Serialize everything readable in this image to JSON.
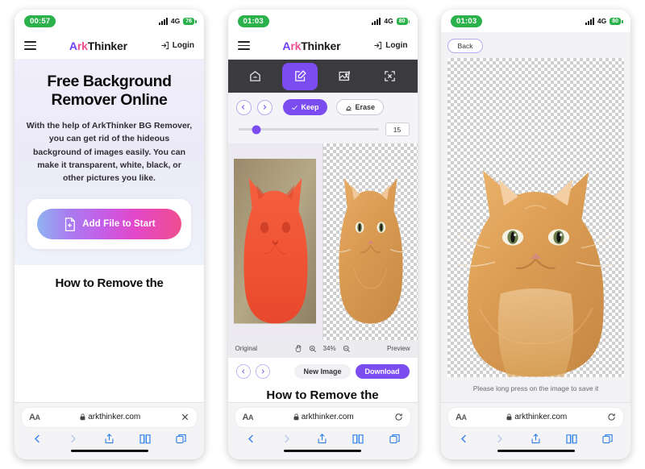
{
  "brand": {
    "prefix": "A",
    "mid": "rk",
    "suffix": "Thinker"
  },
  "phone1": {
    "status": {
      "time": "00:57",
      "network": "4G",
      "battery": "76"
    },
    "header": {
      "login": "Login",
      "menu_icon": "hamburger-menu-icon",
      "login_icon": "login-arrow-icon"
    },
    "hero": {
      "title": "Free Background Remover Online",
      "paragraph": "With the help of ArkThinker BG Remover, you can get rid of the hideous background of images easily. You can make it transparent, white, black, or other pictures you like."
    },
    "cta": {
      "label": "Add File to Start",
      "icon": "file-plus-icon"
    },
    "section_heading": "How to Remove the",
    "safari": {
      "aa": "AA",
      "url": "arkthinker.com",
      "lock_icon": "lock-icon",
      "right_icon": "close-icon"
    }
  },
  "phone2": {
    "status": {
      "time": "01:03",
      "network": "4G",
      "battery": "80"
    },
    "header": {
      "login": "Login"
    },
    "tabs": [
      {
        "name": "home-tab",
        "icon": "home-icon",
        "active": false
      },
      {
        "name": "edit-tab",
        "icon": "edit-pencil-icon",
        "active": true
      },
      {
        "name": "background-tab",
        "icon": "image-icon",
        "active": false
      },
      {
        "name": "resize-tab",
        "icon": "resize-arrows-icon",
        "active": false
      }
    ],
    "controls": {
      "undo_icon": "undo-icon",
      "redo_icon": "redo-icon",
      "keep_label": "Keep",
      "erase_label": "Erase",
      "brush_size": "15"
    },
    "zoombar": {
      "original_label": "Original",
      "hand_icon": "hand-icon",
      "zoom_in_icon": "zoom-in-icon",
      "zoom_level": "34%",
      "zoom_out_icon": "zoom-out-icon",
      "preview_label": "Preview"
    },
    "actions": {
      "prev_icon": "chevron-left-icon",
      "next_icon": "chevron-right-icon",
      "new_image_label": "New Image",
      "download_label": "Download"
    },
    "section_heading": "How to Remove the",
    "safari": {
      "aa": "AA",
      "url": "arkthinker.com",
      "lock_icon": "lock-icon",
      "right_icon": "reload-icon"
    }
  },
  "phone3": {
    "status": {
      "time": "01:03",
      "network": "4G",
      "battery": "80"
    },
    "back_label": "Back",
    "save_hint": "Please long press on the image to save it",
    "safari": {
      "aa": "AA",
      "url": "arkthinker.com",
      "lock_icon": "lock-icon",
      "right_icon": "reload-icon"
    }
  },
  "colors": {
    "purple": "#7b4df0",
    "pink": "#ef4d8f",
    "green": "#2bb24c",
    "safari_blue": "#2f7fe8",
    "editor_dark": "#3b3b3f"
  },
  "safari_toolbar": {
    "back_icon": "chevron-back-icon",
    "forward_icon": "chevron-forward-icon",
    "share_icon": "share-icon",
    "bookmarks_icon": "book-icon",
    "tabs_icon": "tabs-icon"
  }
}
